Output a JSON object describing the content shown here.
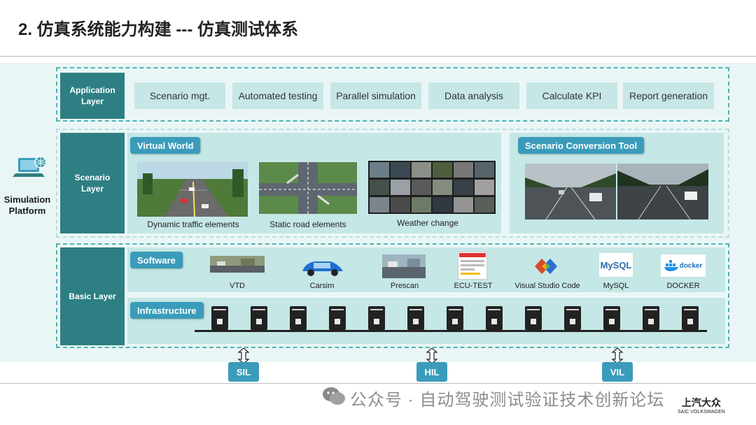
{
  "title": "2. 仿真系统能力构建 --- 仿真测试体系",
  "platform": {
    "label_line1": "Simulation",
    "label_line2": "Platform"
  },
  "application_layer": {
    "label": "Application Layer",
    "items": [
      "Scenario mgt.",
      "Automated testing",
      "Parallel simulation",
      "Data analysis",
      "Calculate KPI",
      "Report generation"
    ]
  },
  "scenario_layer": {
    "label": "Scenario Layer",
    "virtual_world": {
      "title": "Virtual World",
      "captions": [
        "Dynamic traffic elements",
        "Static road elements",
        "Weather change"
      ]
    },
    "conversion_tool": {
      "title": "Scenario Conversion Tool"
    }
  },
  "basic_layer": {
    "label": "Basic Layer",
    "software": {
      "title": "Software",
      "items": [
        "VTD",
        "Carsim",
        "Prescan",
        "ECU-TEST",
        "Visual Studio Code",
        "MySQL",
        "DOCKER"
      ]
    },
    "infrastructure": {
      "title": "Infrastructure",
      "server_count": 13
    }
  },
  "modes": [
    "SIL",
    "HIL",
    "VIL"
  ],
  "icon_text": {
    "mysql": "MySQL",
    "docker": "docker"
  },
  "watermark": "公众号 · 自动驾驶测试验证技术创新论坛",
  "brand": {
    "cn": "上汽大众",
    "en": "SAIC VOLKSWAGEN"
  },
  "colors": {
    "teal_dark": "#2e7f83",
    "teal_light": "#c5e7e6",
    "tag_blue": "#3a9cba",
    "dashed": "#4fb3b0"
  }
}
